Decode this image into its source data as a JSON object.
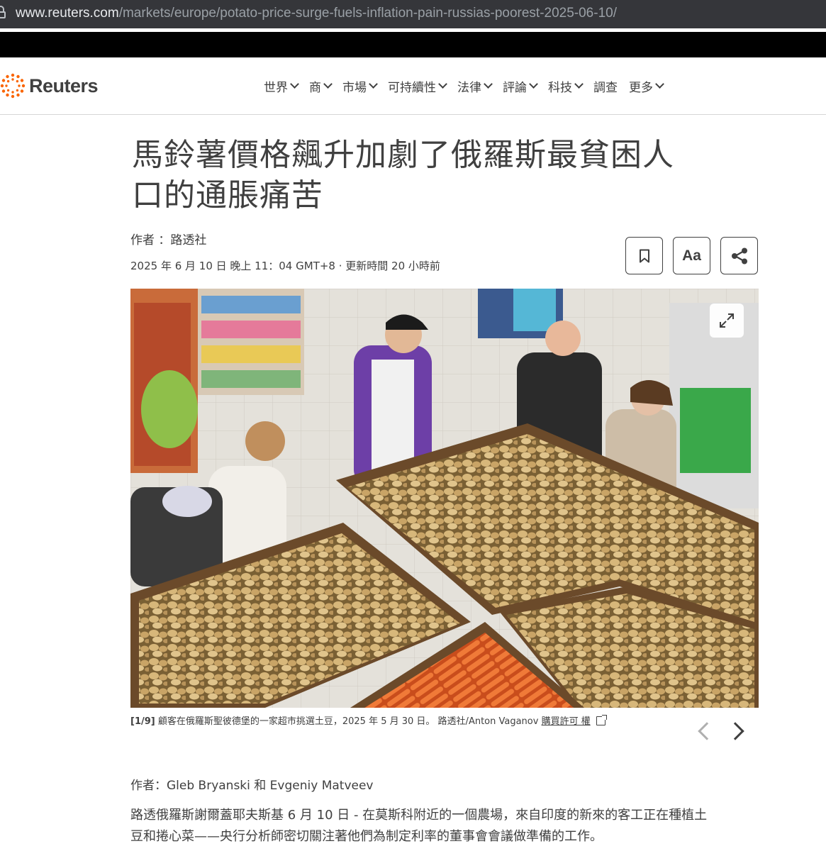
{
  "browser": {
    "url_domain": "www.reuters.com",
    "url_path": "/markets/europe/potato-price-surge-fuels-inflation-pain-russias-poorest-2025-06-10/",
    "lock_icon": "lock-icon"
  },
  "header": {
    "logo_text": "Reuters",
    "logo_color": "#fa6400",
    "nav": [
      {
        "label": "世界",
        "has_menu": true
      },
      {
        "label": "商",
        "has_menu": true
      },
      {
        "label": "市場",
        "has_menu": true
      },
      {
        "label": "可持續性",
        "has_menu": true
      },
      {
        "label": "法律",
        "has_menu": true
      },
      {
        "label": "評論",
        "has_menu": true
      },
      {
        "label": "科技",
        "has_menu": true
      },
      {
        "label": "調查",
        "has_menu": false
      },
      {
        "label": "更多",
        "has_menu": true
      }
    ]
  },
  "article": {
    "headline_line1": "馬鈴薯價格飆升加劇了俄羅斯最貧困人",
    "headline_line2": "口的通脹痛苦",
    "byline": "作者 ：路透社",
    "dateline": "2025 年 6 月 10 日 晚上 11：04 GMT+8 · 更新時間 20 小時前",
    "tools": {
      "bookmark_icon": "bookmark-icon",
      "text_size_label": "Aa",
      "share_icon": "share-icon"
    },
    "photo": {
      "caption_count": "[1/9]",
      "caption_text": " 顧客在俄羅斯聖彼德堡的一家超市挑選土豆，2025 年 5 月 30 日。 路透社/Anton Vaganov ",
      "license_label": "購買許可 權",
      "expand_icon": "expand-icon"
    },
    "authors": "作者：Gleb Bryanski 和 Evgeniy Matveev",
    "body_line1": "路透俄羅斯謝爾蓋耶夫斯基 6 月 10 日 - 在莫斯科附近的一個農場，來自印度的新來的客工正在種植土",
    "body_line2": "豆和捲心菜——央行分析師密切關注著他們為制定利率的董事會會議做準備的工作。"
  }
}
